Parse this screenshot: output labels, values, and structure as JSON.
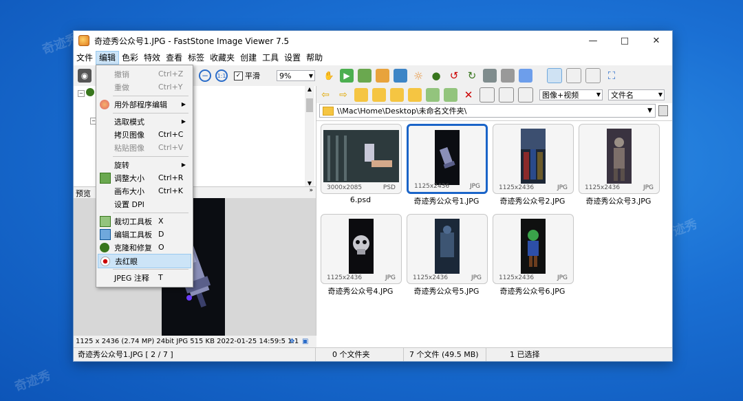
{
  "window": {
    "title": "奇迹秀公众号1.JPG  -  FastStone Image Viewer 7.5"
  },
  "menubar": [
    "文件",
    "编辑",
    "色彩",
    "特效",
    "查看",
    "标签",
    "收藏夹",
    "创建",
    "工具",
    "设置",
    "帮助"
  ],
  "toolbar": {
    "smooth_label": "平滑",
    "zoom_value": "9%"
  },
  "edit_menu": [
    {
      "label": "撤销",
      "key": "Ctrl+Z",
      "disabled": true
    },
    {
      "label": "重做",
      "key": "Ctrl+Y",
      "disabled": true
    },
    {
      "label": "用外部程序编辑",
      "key": "",
      "submenu": true
    },
    {
      "label": "选取模式",
      "key": "",
      "submenu": true
    },
    {
      "label": "拷贝图像",
      "key": "Ctrl+C"
    },
    {
      "label": "粘贴图像",
      "key": "Ctrl+V",
      "disabled": true
    },
    {
      "label": "旋转",
      "key": "",
      "submenu": true
    },
    {
      "label": "调整大小",
      "key": "Ctrl+R"
    },
    {
      "label": "画布大小",
      "key": "Ctrl+K"
    },
    {
      "label": "设置 DPI",
      "key": ""
    },
    {
      "label": "裁切工具板",
      "key": "X"
    },
    {
      "label": "编辑工具板",
      "key": "D"
    },
    {
      "label": "克隆和修复",
      "key": "O"
    },
    {
      "label": "去红眼",
      "key": "",
      "highlight": true
    },
    {
      "label": "JPEG 注释",
      "key": "T"
    }
  ],
  "left_pane": {
    "preview_label": "预览",
    "info": "1125 x 2436 (2.74 MP)  24bit  JPG  515 KB  2022-01-25 14:59:5  1:1"
  },
  "browser": {
    "view_mode": "图像+视频",
    "sort_by": "文件名",
    "path": "\\\\Mac\\Home\\Desktop\\未命名文件夹\\"
  },
  "thumbnails": [
    {
      "name": "6.psd",
      "dims": "3000x2085",
      "type": "PSD",
      "selected": false
    },
    {
      "name": "奇迹秀公众号1.JPG",
      "dims": "1125x2436",
      "type": "JPG",
      "selected": true
    },
    {
      "name": "奇迹秀公众号2.JPG",
      "dims": "1125x2436",
      "type": "JPG",
      "selected": false
    },
    {
      "name": "奇迹秀公众号3.JPG",
      "dims": "1125x2436",
      "type": "JPG",
      "selected": false
    },
    {
      "name": "奇迹秀公众号4.JPG",
      "dims": "1125x2436",
      "type": "JPG",
      "selected": false
    },
    {
      "name": "奇迹秀公众号5.JPG",
      "dims": "1125x2436",
      "type": "JPG",
      "selected": false
    },
    {
      "name": "奇迹秀公众号6.JPG",
      "dims": "1125x2436",
      "type": "JPG",
      "selected": false
    }
  ],
  "statusbar": {
    "current": "奇迹秀公众号1.JPG [ 2 / 7 ]",
    "folders": "0 个文件夹",
    "files": "7 个文件 (49.5 MB)",
    "selected": "1 已选择"
  },
  "watermark": "奇迹秀",
  "colors": {
    "desktop": "#1a6fd3",
    "selection_border": "#1a64c8",
    "menu_highlight": "#cce4f7"
  }
}
